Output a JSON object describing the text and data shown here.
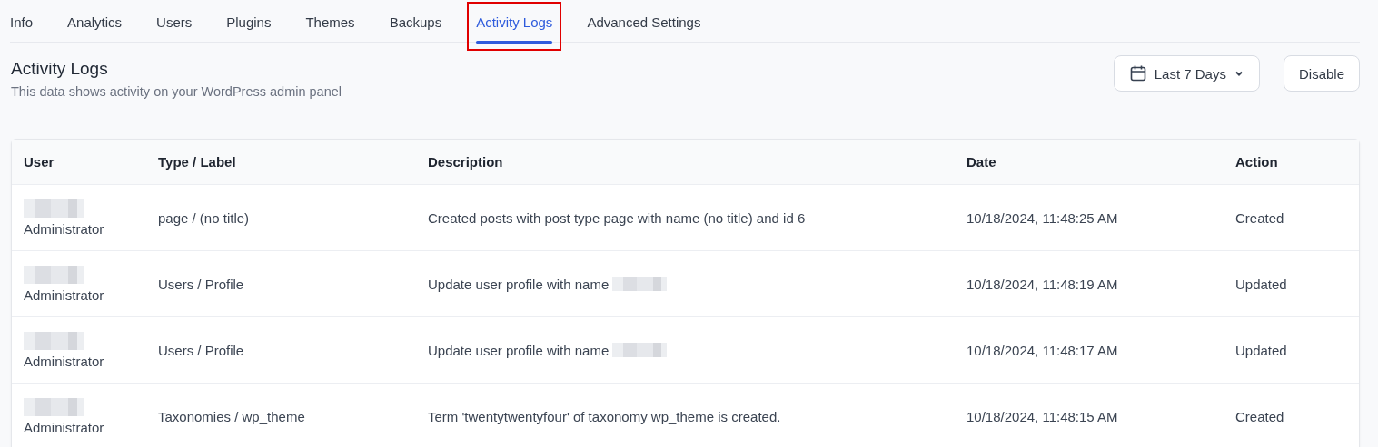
{
  "tabs": [
    {
      "label": "Info",
      "selected": false
    },
    {
      "label": "Analytics",
      "selected": false
    },
    {
      "label": "Users",
      "selected": false
    },
    {
      "label": "Plugins",
      "selected": false
    },
    {
      "label": "Themes",
      "selected": false
    },
    {
      "label": "Backups",
      "selected": false
    },
    {
      "label": "Activity Logs",
      "selected": true,
      "highlighted": true
    },
    {
      "label": "Advanced Settings",
      "selected": false
    }
  ],
  "header": {
    "title": "Activity Logs",
    "subtitle": "This data shows activity on your WordPress admin panel"
  },
  "range_button": {
    "label": "Last 7 Days"
  },
  "disable_button": {
    "label": "Disable"
  },
  "table": {
    "columns": [
      "User",
      "Type / Label",
      "Description",
      "Date",
      "Action"
    ],
    "rows": [
      {
        "user_redacted": true,
        "role": "Administrator",
        "type": "page / (no title)",
        "description": "Created posts with post type page with name (no title) and id 6",
        "description_redacted": false,
        "date": "10/18/2024, 11:48:25 AM",
        "action": "Created"
      },
      {
        "user_redacted": true,
        "role": "Administrator",
        "type": "Users / Profile",
        "description": "Update user profile with name",
        "description_redacted": true,
        "date": "10/18/2024, 11:48:19 AM",
        "action": "Updated"
      },
      {
        "user_redacted": true,
        "role": "Administrator",
        "type": "Users / Profile",
        "description": "Update user profile with name",
        "description_redacted": true,
        "date": "10/18/2024, 11:48:17 AM",
        "action": "Updated"
      },
      {
        "user_redacted": true,
        "role": "Administrator",
        "type": "Taxonomies / wp_theme",
        "description": "Term 'twentytwentyfour' of taxonomy wp_theme is created.",
        "description_redacted": false,
        "date": "10/18/2024, 11:48:15 AM",
        "action": "Created"
      }
    ]
  }
}
